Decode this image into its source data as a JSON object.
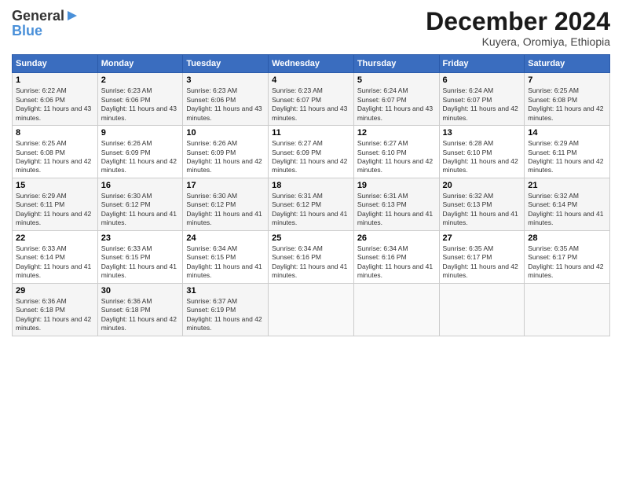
{
  "header": {
    "logo_line1": "General",
    "logo_line2": "Blue",
    "month_title": "December 2024",
    "subtitle": "Kuyera, Oromiya, Ethiopia"
  },
  "calendar": {
    "days_of_week": [
      "Sunday",
      "Monday",
      "Tuesday",
      "Wednesday",
      "Thursday",
      "Friday",
      "Saturday"
    ],
    "weeks": [
      [
        {
          "day": "1",
          "sunrise": "Sunrise: 6:22 AM",
          "sunset": "Sunset: 6:06 PM",
          "daylight": "Daylight: 11 hours and 43 minutes."
        },
        {
          "day": "2",
          "sunrise": "Sunrise: 6:23 AM",
          "sunset": "Sunset: 6:06 PM",
          "daylight": "Daylight: 11 hours and 43 minutes."
        },
        {
          "day": "3",
          "sunrise": "Sunrise: 6:23 AM",
          "sunset": "Sunset: 6:06 PM",
          "daylight": "Daylight: 11 hours and 43 minutes."
        },
        {
          "day": "4",
          "sunrise": "Sunrise: 6:23 AM",
          "sunset": "Sunset: 6:07 PM",
          "daylight": "Daylight: 11 hours and 43 minutes."
        },
        {
          "day": "5",
          "sunrise": "Sunrise: 6:24 AM",
          "sunset": "Sunset: 6:07 PM",
          "daylight": "Daylight: 11 hours and 43 minutes."
        },
        {
          "day": "6",
          "sunrise": "Sunrise: 6:24 AM",
          "sunset": "Sunset: 6:07 PM",
          "daylight": "Daylight: 11 hours and 42 minutes."
        },
        {
          "day": "7",
          "sunrise": "Sunrise: 6:25 AM",
          "sunset": "Sunset: 6:08 PM",
          "daylight": "Daylight: 11 hours and 42 minutes."
        }
      ],
      [
        {
          "day": "8",
          "sunrise": "Sunrise: 6:25 AM",
          "sunset": "Sunset: 6:08 PM",
          "daylight": "Daylight: 11 hours and 42 minutes."
        },
        {
          "day": "9",
          "sunrise": "Sunrise: 6:26 AM",
          "sunset": "Sunset: 6:09 PM",
          "daylight": "Daylight: 11 hours and 42 minutes."
        },
        {
          "day": "10",
          "sunrise": "Sunrise: 6:26 AM",
          "sunset": "Sunset: 6:09 PM",
          "daylight": "Daylight: 11 hours and 42 minutes."
        },
        {
          "day": "11",
          "sunrise": "Sunrise: 6:27 AM",
          "sunset": "Sunset: 6:09 PM",
          "daylight": "Daylight: 11 hours and 42 minutes."
        },
        {
          "day": "12",
          "sunrise": "Sunrise: 6:27 AM",
          "sunset": "Sunset: 6:10 PM",
          "daylight": "Daylight: 11 hours and 42 minutes."
        },
        {
          "day": "13",
          "sunrise": "Sunrise: 6:28 AM",
          "sunset": "Sunset: 6:10 PM",
          "daylight": "Daylight: 11 hours and 42 minutes."
        },
        {
          "day": "14",
          "sunrise": "Sunrise: 6:29 AM",
          "sunset": "Sunset: 6:11 PM",
          "daylight": "Daylight: 11 hours and 42 minutes."
        }
      ],
      [
        {
          "day": "15",
          "sunrise": "Sunrise: 6:29 AM",
          "sunset": "Sunset: 6:11 PM",
          "daylight": "Daylight: 11 hours and 42 minutes."
        },
        {
          "day": "16",
          "sunrise": "Sunrise: 6:30 AM",
          "sunset": "Sunset: 6:12 PM",
          "daylight": "Daylight: 11 hours and 41 minutes."
        },
        {
          "day": "17",
          "sunrise": "Sunrise: 6:30 AM",
          "sunset": "Sunset: 6:12 PM",
          "daylight": "Daylight: 11 hours and 41 minutes."
        },
        {
          "day": "18",
          "sunrise": "Sunrise: 6:31 AM",
          "sunset": "Sunset: 6:12 PM",
          "daylight": "Daylight: 11 hours and 41 minutes."
        },
        {
          "day": "19",
          "sunrise": "Sunrise: 6:31 AM",
          "sunset": "Sunset: 6:13 PM",
          "daylight": "Daylight: 11 hours and 41 minutes."
        },
        {
          "day": "20",
          "sunrise": "Sunrise: 6:32 AM",
          "sunset": "Sunset: 6:13 PM",
          "daylight": "Daylight: 11 hours and 41 minutes."
        },
        {
          "day": "21",
          "sunrise": "Sunrise: 6:32 AM",
          "sunset": "Sunset: 6:14 PM",
          "daylight": "Daylight: 11 hours and 41 minutes."
        }
      ],
      [
        {
          "day": "22",
          "sunrise": "Sunrise: 6:33 AM",
          "sunset": "Sunset: 6:14 PM",
          "daylight": "Daylight: 11 hours and 41 minutes."
        },
        {
          "day": "23",
          "sunrise": "Sunrise: 6:33 AM",
          "sunset": "Sunset: 6:15 PM",
          "daylight": "Daylight: 11 hours and 41 minutes."
        },
        {
          "day": "24",
          "sunrise": "Sunrise: 6:34 AM",
          "sunset": "Sunset: 6:15 PM",
          "daylight": "Daylight: 11 hours and 41 minutes."
        },
        {
          "day": "25",
          "sunrise": "Sunrise: 6:34 AM",
          "sunset": "Sunset: 6:16 PM",
          "daylight": "Daylight: 11 hours and 41 minutes."
        },
        {
          "day": "26",
          "sunrise": "Sunrise: 6:34 AM",
          "sunset": "Sunset: 6:16 PM",
          "daylight": "Daylight: 11 hours and 41 minutes."
        },
        {
          "day": "27",
          "sunrise": "Sunrise: 6:35 AM",
          "sunset": "Sunset: 6:17 PM",
          "daylight": "Daylight: 11 hours and 42 minutes."
        },
        {
          "day": "28",
          "sunrise": "Sunrise: 6:35 AM",
          "sunset": "Sunset: 6:17 PM",
          "daylight": "Daylight: 11 hours and 42 minutes."
        }
      ],
      [
        {
          "day": "29",
          "sunrise": "Sunrise: 6:36 AM",
          "sunset": "Sunset: 6:18 PM",
          "daylight": "Daylight: 11 hours and 42 minutes."
        },
        {
          "day": "30",
          "sunrise": "Sunrise: 6:36 AM",
          "sunset": "Sunset: 6:18 PM",
          "daylight": "Daylight: 11 hours and 42 minutes."
        },
        {
          "day": "31",
          "sunrise": "Sunrise: 6:37 AM",
          "sunset": "Sunset: 6:19 PM",
          "daylight": "Daylight: 11 hours and 42 minutes."
        },
        null,
        null,
        null,
        null
      ]
    ]
  }
}
